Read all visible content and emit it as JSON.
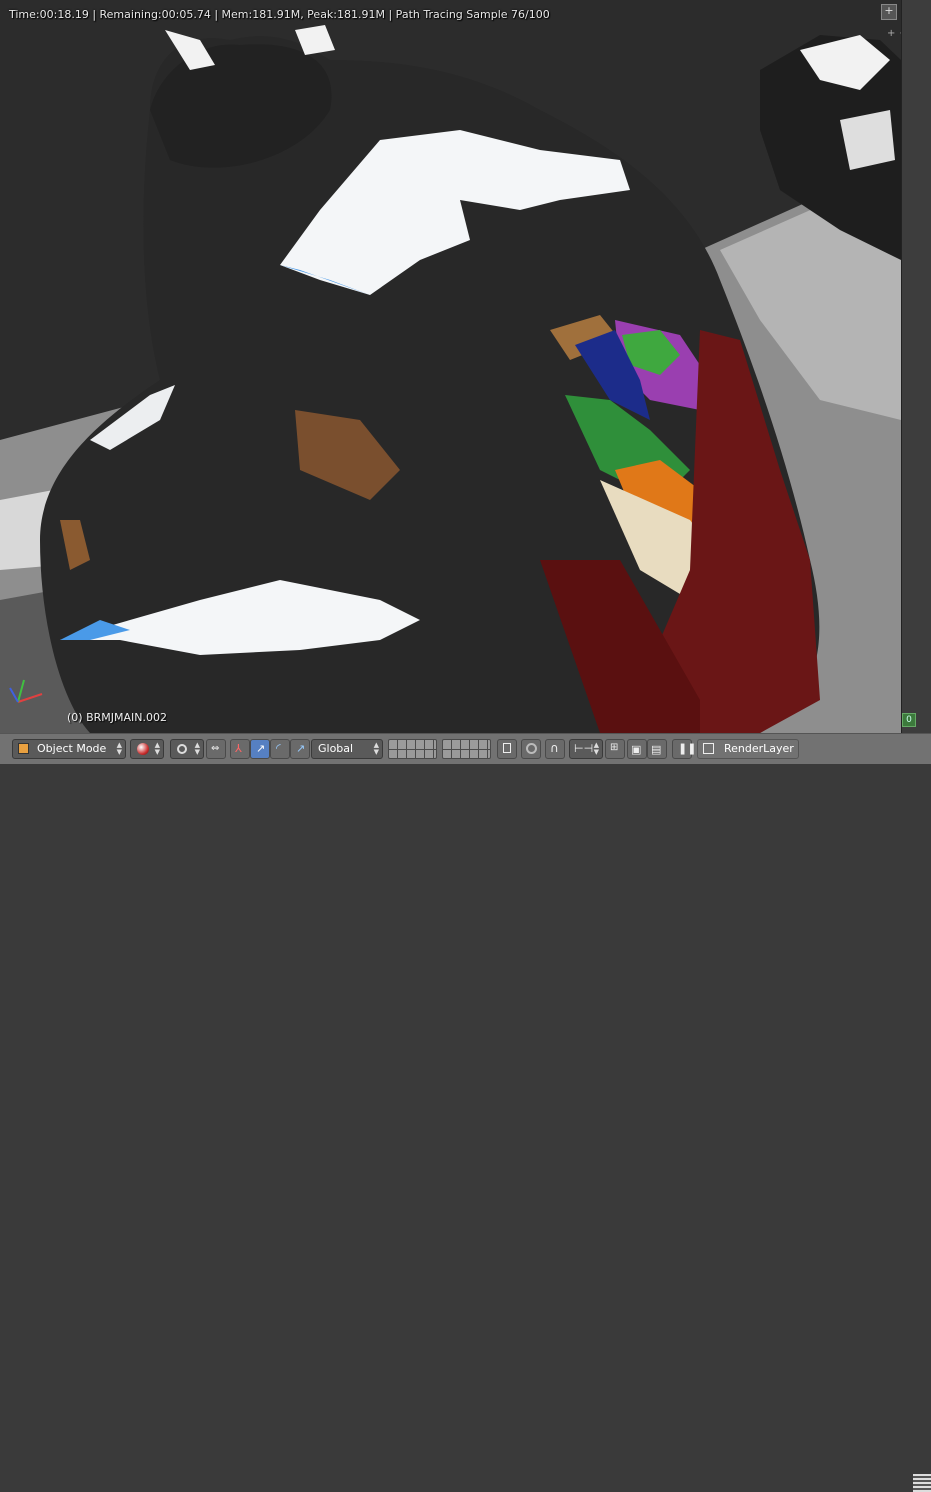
{
  "status_bar": {
    "text": "Time:00:18.19 | Remaining:00:05.74 | Mem:181.91M, Peak:181.91M | Path Tracing Sample 76/100"
  },
  "viewport": {
    "object_label": "(0) BRMJMAIN.002",
    "layer_indicator": "0"
  },
  "header": {
    "mode": "Object Mode",
    "orientation": "Global",
    "render_layer": "RenderLayer"
  },
  "icons": [
    "cube-icon",
    "sphere-shading-icon",
    "pivot-icon",
    "manipulator-icon",
    "translate-icon",
    "rotate-icon",
    "scale-icon",
    "layers-grid-icon",
    "lock-icon",
    "proportional-icon",
    "snap-icon",
    "snap-element-icon",
    "render-icon",
    "camera-icon",
    "pause-icon",
    "renderlayer-icon"
  ],
  "colors": {
    "header_bg": "#727272",
    "active_button": "#5680c2",
    "viewport_bg": "#2b2b2b"
  }
}
